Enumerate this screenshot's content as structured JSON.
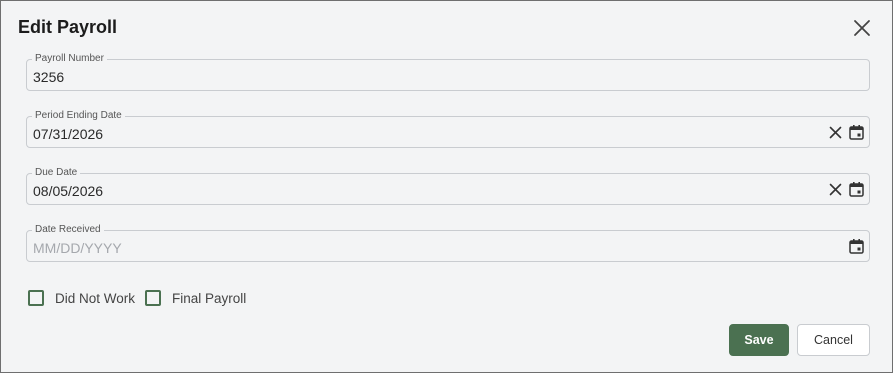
{
  "dialog": {
    "title": "Edit Payroll",
    "close_icon": "close-icon"
  },
  "fields": {
    "payroll_number": {
      "label": "Payroll Number",
      "value": "3256",
      "placeholder": ""
    },
    "period_ending_date": {
      "label": "Period Ending Date",
      "value": "07/31/2026",
      "placeholder": "MM/DD/YYYY"
    },
    "due_date": {
      "label": "Due Date",
      "value": "08/05/2026",
      "placeholder": "MM/DD/YYYY"
    },
    "date_received": {
      "label": "Date Received",
      "value": "",
      "placeholder": "MM/DD/YYYY"
    }
  },
  "checkboxes": {
    "did_not_work": {
      "label": "Did Not Work",
      "checked": false
    },
    "final_payroll": {
      "label": "Final Payroll",
      "checked": false
    }
  },
  "buttons": {
    "save": "Save",
    "cancel": "Cancel"
  },
  "colors": {
    "accent": "#4b7151",
    "background": "#f3f4f5",
    "border": "#c9ccd0"
  },
  "icons": {
    "clear": "clear-icon",
    "calendar": "calendar-icon"
  }
}
